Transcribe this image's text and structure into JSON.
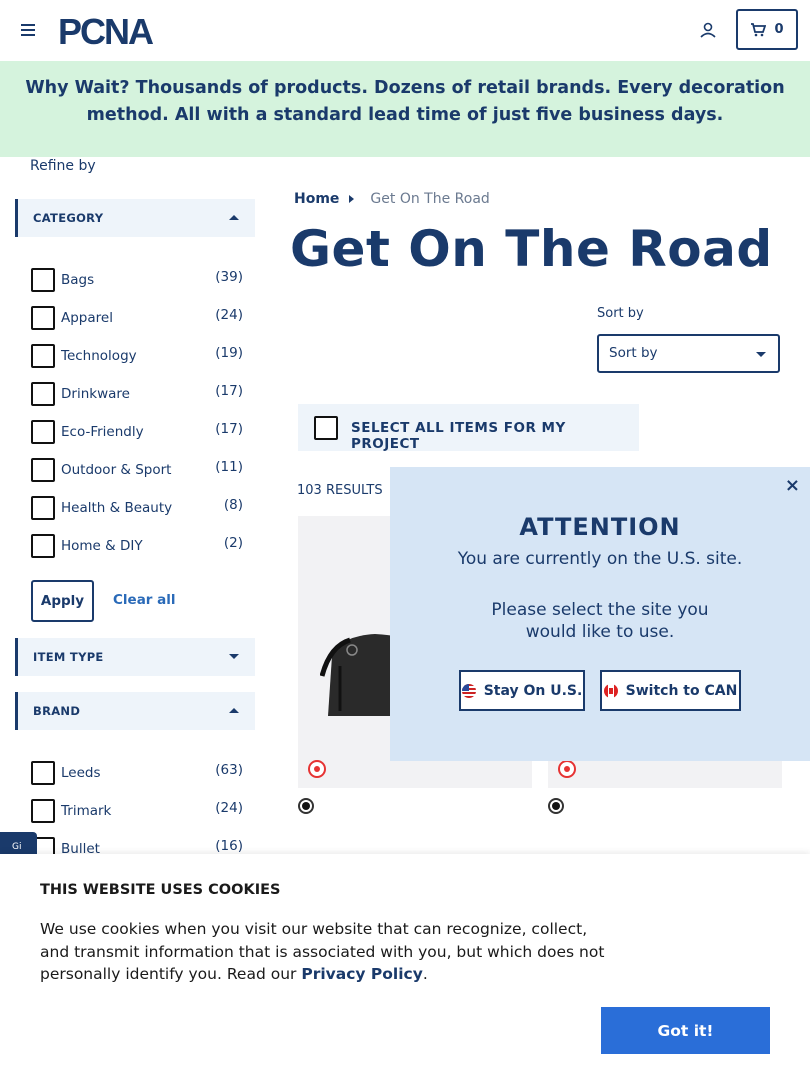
{
  "header": {
    "logo_text": "PCNA",
    "cart_count": "0",
    "accent_color": "#1a3a6b"
  },
  "banner": {
    "text": "Why Wait? Thousands of products. Dozens of retail brands. Every decoration method. All with a standard lead time of just five business days.",
    "background": "#d5f3dd"
  },
  "sidebar": {
    "refine_label": "Refine by",
    "category": {
      "title": "CATEGORY",
      "items": [
        {
          "label": "Bags",
          "count": "(39)"
        },
        {
          "label": "Apparel",
          "count": "(24)"
        },
        {
          "label": "Technology",
          "count": "(19)"
        },
        {
          "label": "Drinkware",
          "count": "(17)"
        },
        {
          "label": "Eco-Friendly",
          "count": "(17)"
        },
        {
          "label": "Outdoor & Sport",
          "count": "(11)"
        },
        {
          "label": "Health & Beauty",
          "count": "(8)"
        },
        {
          "label": "Home & DIY",
          "count": "(2)"
        }
      ]
    },
    "apply_label": "Apply",
    "clear_label": "Clear all",
    "item_type": {
      "title": "ITEM TYPE"
    },
    "brand": {
      "title": "BRAND",
      "items": [
        {
          "label": "Leeds",
          "count": "(63)"
        },
        {
          "label": "Trimark",
          "count": "(24)"
        },
        {
          "label": "Bullet",
          "count": "(16)"
        }
      ]
    },
    "side_tab_text": "Gi"
  },
  "main": {
    "breadcrumb": {
      "home": "Home",
      "current": "Get On The Road"
    },
    "title": "Get On The Road",
    "sort": {
      "label": "Sort by",
      "value": "Sort by"
    },
    "select_all_label": "SELECT ALL ITEMS FOR MY PROJECT",
    "results": "103 RESULTS"
  },
  "modal": {
    "close": "×",
    "title": "ATTENTION",
    "subtitle": "You are currently on the U.S. site.",
    "ask": "Please select the site you would like to use.",
    "stay_label": "Stay On U.S.",
    "switch_label": "Switch to CAN"
  },
  "cookie": {
    "title": "THIS WEBSITE USES COOKIES",
    "text_before": "We use cookies when you visit our website that can recognize, collect, and transmit information that is associated with you, but which does not personally identify you. Read our ",
    "link": "Privacy Policy",
    "text_after": ".",
    "button": "Got it!"
  }
}
